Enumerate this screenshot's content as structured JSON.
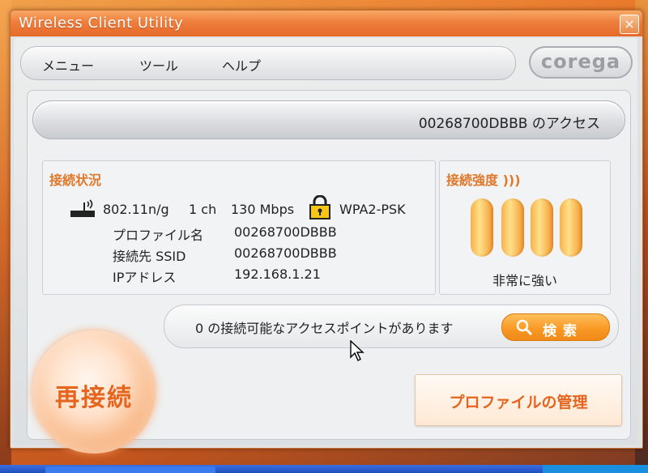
{
  "window": {
    "title": "Wireless Client Utility",
    "close_glyph": "×"
  },
  "menu": {
    "items": [
      "メニュー",
      "ツール",
      "ヘルプ"
    ]
  },
  "brand": {
    "logo_text": "corega"
  },
  "access_point": {
    "text": "00268700DBBB のアクセス"
  },
  "connection_status": {
    "title": "接続状況",
    "standard": "802.11n/g",
    "channel": "1 ch",
    "rate": "130 Mbps",
    "security": "WPA2-PSK",
    "rows": [
      {
        "label": "プロファイル名",
        "value": "00268700DBBB"
      },
      {
        "label": "接続先 SSID",
        "value": "00268700DBBB"
      },
      {
        "label": "IPアドレス",
        "value": "192.168.1.21"
      }
    ]
  },
  "signal": {
    "title": "接続強度 )))",
    "bars_lit": 4,
    "bars_total": 4,
    "label": "非常に強い"
  },
  "scan": {
    "message": "0 の接続可能なアクセスポイントがあります",
    "search_label": "検索"
  },
  "actions": {
    "reconnect_label": "再接続",
    "profile_label": "プロファイルの管理"
  },
  "colors": {
    "accent": "#e5651e",
    "title_bar": "#ef7d3c",
    "button_orange": "#f99a26"
  },
  "icons": {
    "close": "close-icon",
    "antenna": "antenna-icon",
    "lock": "lock-icon",
    "search": "magnifier-icon",
    "cursor": "mouse-cursor-icon"
  }
}
